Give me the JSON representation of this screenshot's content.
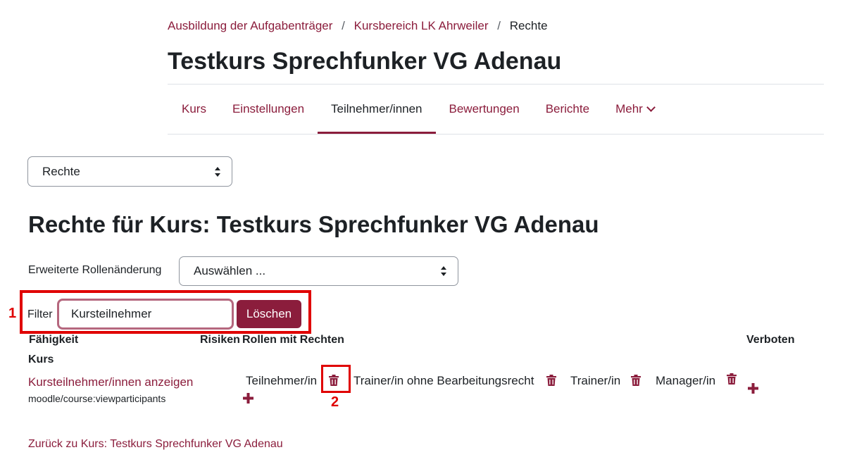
{
  "breadcrumb": {
    "items": [
      "Ausbildung der Aufgabenträger",
      "Kursbereich LK Ahrweiler"
    ],
    "current": "Rechte",
    "separator": "/"
  },
  "course_title": "Testkurs Sprechfunker VG Adenau",
  "nav": {
    "tabs": [
      "Kurs",
      "Einstellungen",
      "Teilnehmer/innen",
      "Bewertungen",
      "Berichte",
      "Mehr"
    ],
    "active": "Teilnehmer/innen"
  },
  "page_select": {
    "value": "Rechte"
  },
  "page_heading": "Rechte für Kurs: Testkurs Sprechfunker VG Adenau",
  "advanced_role_override": {
    "label": "Erweiterte Rollenänderung",
    "value": "Auswählen ..."
  },
  "filter": {
    "label": "Filter",
    "value": "Kursteilnehmer",
    "clear_label": "Löschen"
  },
  "table": {
    "headers": {
      "capability": "Fähigkeit",
      "risks": "Risiken",
      "roles": "Rollen mit Rechten",
      "prohibited": "Verboten"
    },
    "group": "Kurs",
    "rows": [
      {
        "capability_name": "Kursteilnehmer/innen anzeigen",
        "capability_code": "moodle/course:viewparticipants",
        "roles": [
          "Teilnehmer/in",
          "Trainer/in ohne Bearbeitungsrecht",
          "Trainer/in",
          "Manager/in"
        ]
      }
    ]
  },
  "annotations": {
    "callout_1": "1",
    "callout_2": "2"
  },
  "back_link": "Zurück zu Kurs: Testkurs Sprechfunker VG Adenau",
  "colors": {
    "brand": "#8b1d3c",
    "callout": "#e00000",
    "text": "#1d2125",
    "border": "#dee2e6"
  },
  "icons": {
    "delete": "trash-icon",
    "add": "plus-icon",
    "select": "updown-icon",
    "dropdown": "chevron-down-icon"
  }
}
